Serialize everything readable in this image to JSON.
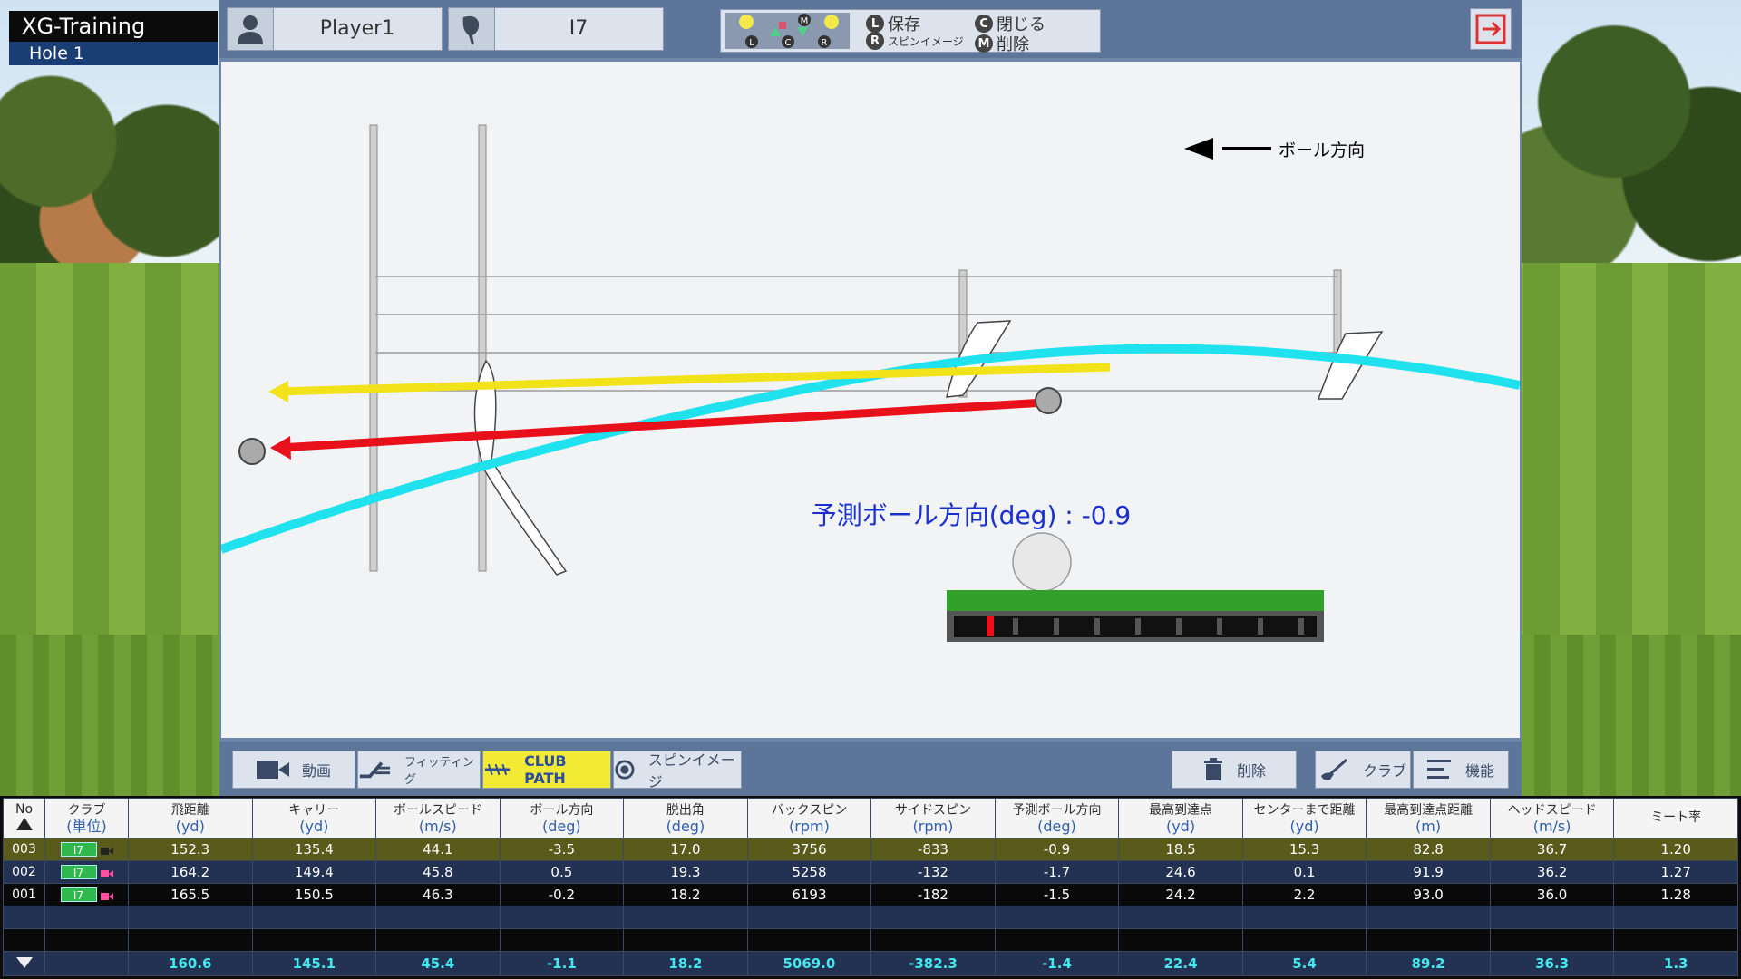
{
  "app": {
    "title": "XG-Training",
    "hole": "Hole 1"
  },
  "player": {
    "name": "Player1"
  },
  "club": {
    "name": "I7"
  },
  "legend": {
    "save_key": "L",
    "save_label": "保存",
    "close_key": "C",
    "close_label": "閉じる",
    "spin_key": "R",
    "spin_label": "スピンイメージ",
    "delete_key": "M",
    "delete_label": "削除"
  },
  "canvas": {
    "ball_direction_label": "ボール方向",
    "predicted_direction": "予測ボール方向(deg) : -0.9",
    "meter_level": 0.1
  },
  "toolbar": {
    "video_label": "動画",
    "fitting_label": "フィッティング",
    "club_path_label": "CLUB PATH",
    "spin_image_label": "スピンイメージ",
    "delete_label": "削除",
    "club_label": "クラブ",
    "function_label": "機能"
  },
  "table": {
    "headers": [
      {
        "title": "No",
        "unit": ""
      },
      {
        "title": "クラブ",
        "unit": "(単位)"
      },
      {
        "title": "飛距離",
        "unit": "(yd)"
      },
      {
        "title": "キャリー",
        "unit": "(yd)"
      },
      {
        "title": "ボールスピード",
        "unit": "(m/s)"
      },
      {
        "title": "ボール方向",
        "unit": "(deg)"
      },
      {
        "title": "脱出角",
        "unit": "(deg)"
      },
      {
        "title": "バックスピン",
        "unit": "(rpm)"
      },
      {
        "title": "サイドスピン",
        "unit": "(rpm)"
      },
      {
        "title": "予測ボール方向",
        "unit": "(deg)"
      },
      {
        "title": "最高到達点",
        "unit": "(yd)"
      },
      {
        "title": "センターまで距離",
        "unit": "(yd)"
      },
      {
        "title": "最高到達点距離",
        "unit": "(m)"
      },
      {
        "title": "ヘッドスピード",
        "unit": "(m/s)"
      },
      {
        "title": "ミート率",
        "unit": ""
      }
    ],
    "rows": [
      {
        "no": "003",
        "club": "I7",
        "values": [
          "152.3",
          "135.4",
          "44.1",
          "-3.5",
          "17.0",
          "3756",
          "-833",
          "-0.9",
          "18.5",
          "15.3",
          "82.8",
          "36.7",
          "1.20"
        ]
      },
      {
        "no": "002",
        "club": "I7",
        "values": [
          "164.2",
          "149.4",
          "45.8",
          "0.5",
          "19.3",
          "5258",
          "-132",
          "-1.7",
          "24.6",
          "0.1",
          "91.9",
          "36.2",
          "1.27"
        ]
      },
      {
        "no": "001",
        "club": "I7",
        "values": [
          "165.5",
          "150.5",
          "46.3",
          "-0.2",
          "18.2",
          "6193",
          "-182",
          "-1.5",
          "24.2",
          "2.2",
          "93.0",
          "36.0",
          "1.28"
        ]
      }
    ],
    "averages": [
      "160.6",
      "145.1",
      "45.4",
      "-1.1",
      "18.2",
      "5069.0",
      "-382.3",
      "-1.4",
      "22.4",
      "5.4",
      "89.2",
      "36.3",
      "1.3"
    ]
  },
  "colors": {
    "club_path_line": "#f2e21a",
    "face_line": "#e8101a",
    "trajectory": "#1fe2ee",
    "predicted_text": "#1a2fd0",
    "active_tab": "#f3ea35"
  }
}
